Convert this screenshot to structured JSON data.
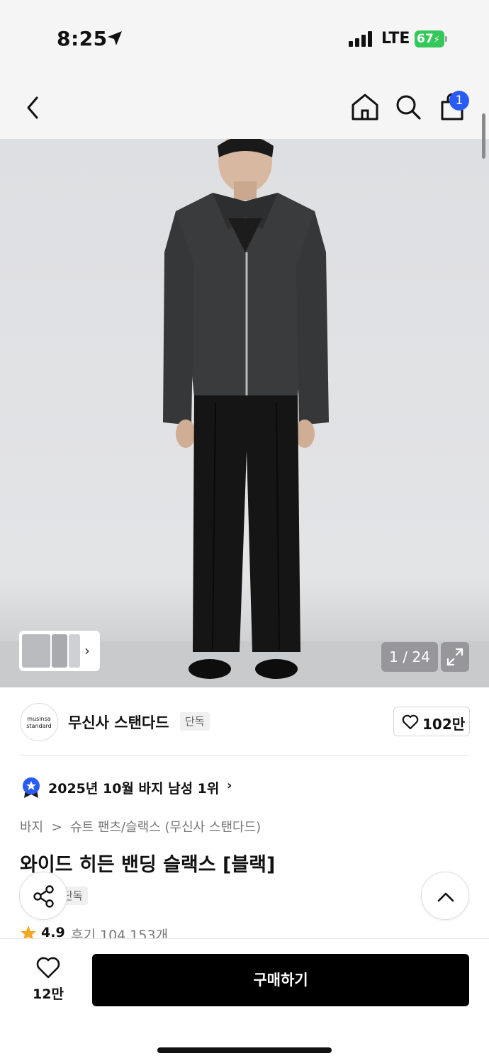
{
  "status_bar": {
    "time": "8:25",
    "network": "LTE",
    "battery": "67"
  },
  "nav": {
    "cart_count": "1"
  },
  "gallery": {
    "counter": "1 / 24"
  },
  "brand": {
    "logo_line1": "musinsa",
    "logo_line2": "standard",
    "name": "무신사 스탠다드",
    "tag": "단독",
    "likes": "102만"
  },
  "ranking": {
    "text": "2025년 10월 바지 남성 1위",
    "chevron": "›"
  },
  "breadcrumb": "바지  >  슈트 팬츠/슬랙스 (무신사 스탠다드)",
  "product": {
    "name": "와이드 히든 밴딩 슬랙스 [블랙]",
    "tag": "단독",
    "rating": "4.9",
    "reviews": "후기 104,153개"
  },
  "bottom_bar": {
    "wish_count": "12만",
    "buy_label": "구매하기"
  },
  "colors": {
    "badge": "#2a5cf5",
    "buy_button": "#000000",
    "battery": "#34c759",
    "star": "#f5a623"
  }
}
